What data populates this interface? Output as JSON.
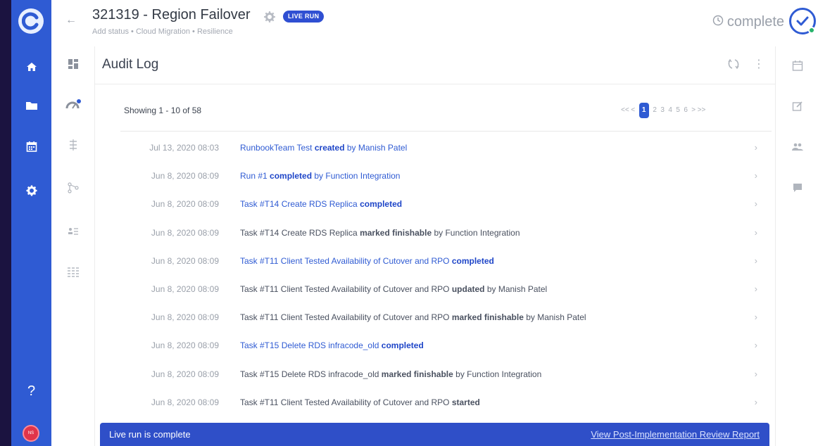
{
  "header": {
    "title": "321319 - Region Failover",
    "badge": "LIVE RUN",
    "breadcrumb": "Add status • Cloud Migration • Resilience",
    "status": "complete"
  },
  "icons": {
    "rail": [
      "home-icon",
      "folder-icon",
      "calendar-icon",
      "settings-icon"
    ],
    "subnav": [
      "dashboard-icon",
      "runbook-dashboard-icon",
      "task-list-icon",
      "workflow-icon",
      "team-list-icon",
      "grid-icon"
    ],
    "right_rail": [
      "calendar-icon",
      "edit-icon",
      "people-icon",
      "comment-icon"
    ]
  },
  "rail": {
    "help": "?",
    "avatar_initials": "NS"
  },
  "panel": {
    "title": "Audit Log",
    "showing": "Showing 1 - 10 of 58",
    "pager": {
      "first": "<<",
      "prev": "<",
      "pages": [
        "1",
        "2",
        "3",
        "4",
        "5",
        "6"
      ],
      "next": ">",
      "last": ">>"
    }
  },
  "rows": [
    {
      "date": "Jul 13, 2020 08:03",
      "pre": "RunbookTeam Test ",
      "bold": "created",
      "post": " by Manish Patel",
      "link": true
    },
    {
      "date": "Jun 8, 2020 08:09",
      "pre": "Run #1 ",
      "bold": "completed",
      "post": " by Function Integration",
      "link": true
    },
    {
      "date": "Jun 8, 2020 08:09",
      "pre": "Task #T14 Create RDS Replica ",
      "bold": "completed",
      "post": "",
      "link": true
    },
    {
      "date": "Jun 8, 2020 08:09",
      "pre": "Task #T14 Create RDS Replica ",
      "bold": "marked finishable",
      "post": " by Function Integration",
      "link": false
    },
    {
      "date": "Jun 8, 2020 08:09",
      "pre": "Task #T11 Client Tested Availability of Cutover and RPO ",
      "bold": "completed",
      "post": "",
      "link": true
    },
    {
      "date": "Jun 8, 2020 08:09",
      "pre": "Task #T11 Client Tested Availability of Cutover and RPO ",
      "bold": "updated",
      "post": " by Manish Patel",
      "link": false
    },
    {
      "date": "Jun 8, 2020 08:09",
      "pre": "Task #T11 Client Tested Availability of Cutover and RPO ",
      "bold": "marked finishable",
      "post": " by Manish Patel",
      "link": false
    },
    {
      "date": "Jun 8, 2020 08:09",
      "pre": "Task #T15 Delete RDS infracode_old ",
      "bold": "completed",
      "post": "",
      "link": true
    },
    {
      "date": "Jun 8, 2020 08:09",
      "pre": "Task #T15 Delete RDS infracode_old ",
      "bold": "marked finishable",
      "post": " by Function Integration",
      "link": false
    },
    {
      "date": "Jun 8, 2020 08:09",
      "pre": "Task #T11 Client Tested Availability of Cutover and RPO ",
      "bold": "started",
      "post": "",
      "link": false
    }
  ],
  "banner": {
    "message": "Live run is complete",
    "link": "View Post-Implementation Review Report"
  },
  "colors": {
    "brand": "#2f5bd3",
    "banner": "#2f4fc8",
    "background": "#1b1340"
  }
}
